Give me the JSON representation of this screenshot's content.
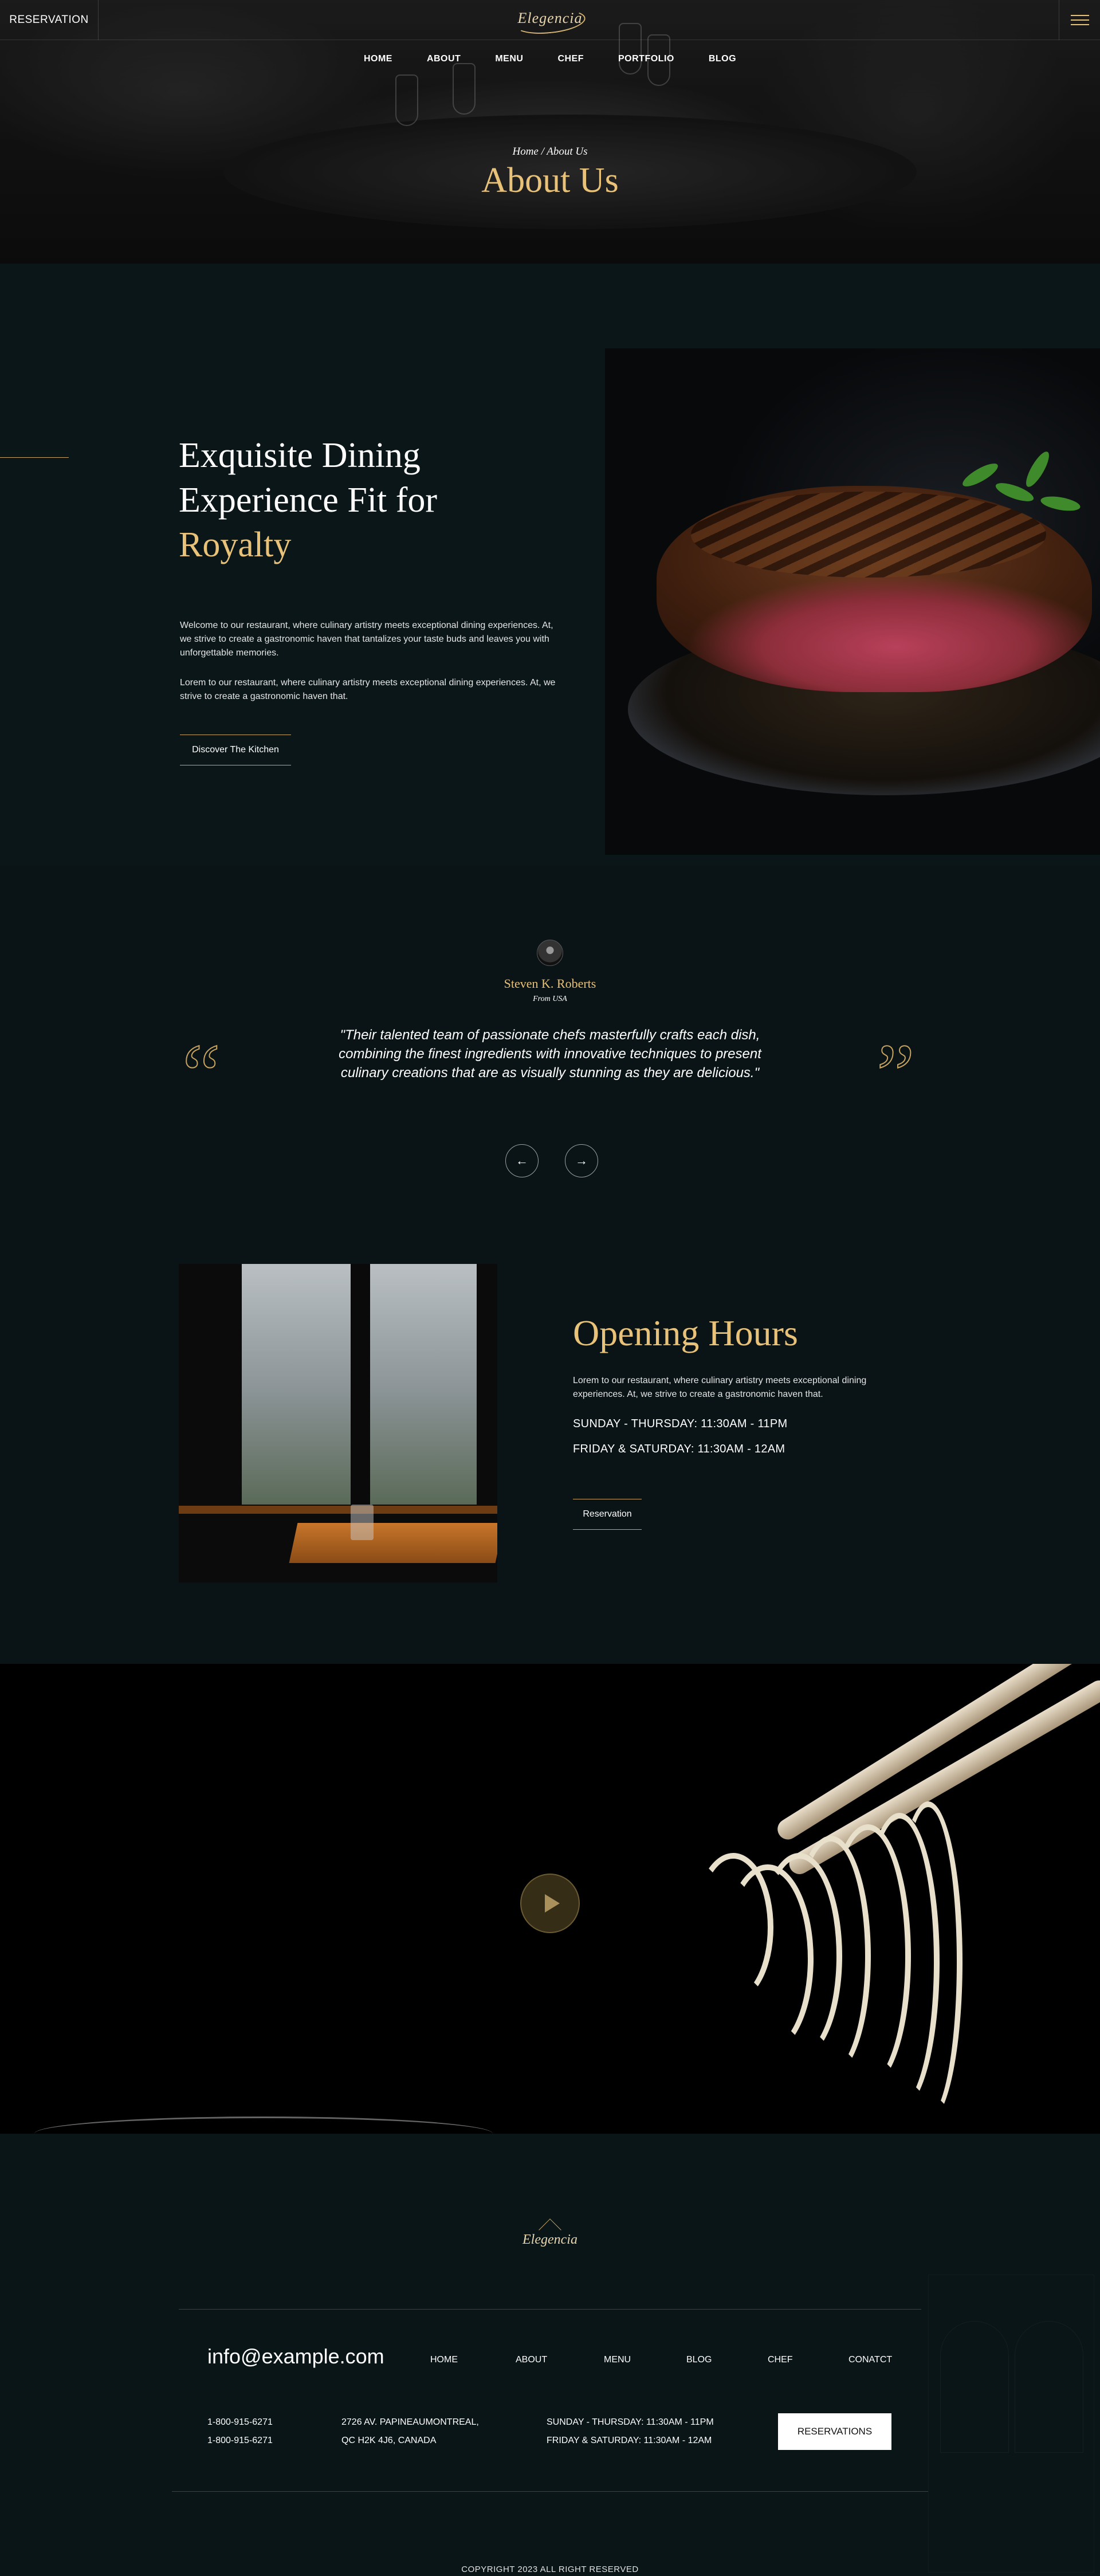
{
  "topbar": {
    "reservation_label": "RESERVATION",
    "logo_text": "Elegencia"
  },
  "nav": {
    "items": [
      "HOME",
      "ABOUT",
      "MENU",
      "CHEF",
      "PORTFOLIO",
      "BLOG"
    ]
  },
  "hero": {
    "breadcrumb": "Home / About Us",
    "title": "About Us"
  },
  "about": {
    "title_line1": "Exquisite Dining",
    "title_line2": "Experience Fit for",
    "title_line3": "Royalty",
    "paragraph1": "Welcome to our restaurant, where culinary artistry meets exceptional dining experiences. At, we strive to create a gastronomic haven that tantalizes your taste buds and leaves you with unforgettable memories.",
    "paragraph2": "Lorem to our restaurant, where culinary artistry meets exceptional dining experiences. At, we strive to create a gastronomic haven that.",
    "button_label": "Discover The Kitchen"
  },
  "testimonial": {
    "name": "Steven K. Roberts",
    "from": "From USA",
    "quote": "\"Their talented team of passionate chefs masterfully crafts each dish, combining the finest ingredients with innovative techniques to present culinary creations that are as visually stunning as they are delicious.\"",
    "prev_icon": "←",
    "next_icon": "→"
  },
  "hours": {
    "title": "Opening Hours",
    "paragraph": "Lorem to our restaurant, where culinary artistry meets exceptional dining experiences. At, we strive to create a gastronomic haven that.",
    "line1": "SUNDAY - THURSDAY: 11:30AM - 11PM",
    "line2": "FRIDAY & SATURDAY: 11:30AM - 12AM",
    "button_label": "Reservation"
  },
  "footer": {
    "logo_text": "Elegencia",
    "email": "info@example.com",
    "nav": [
      "HOME",
      "ABOUT",
      "MENU",
      "BLOG",
      "CHEF",
      "CONATCT"
    ],
    "phone1": "1-800-915-6271",
    "phone2": "1-800-915-6271",
    "address1": "2726 AV. PAPINEAUMONTREAL,",
    "address2": "QC H2K 4J6, CANADA",
    "hours1": "SUNDAY - THURSDAY: 11:30AM - 11PM",
    "hours2": "FRIDAY & SATURDAY: 11:30AM - 12AM",
    "reservations_label": "RESERVATIONS",
    "copyright": "COPYRIGHT 2023 ALL RIGHT RESERVED"
  },
  "colors": {
    "accent_gold": "#e9c27a",
    "background": "#0a1416"
  }
}
